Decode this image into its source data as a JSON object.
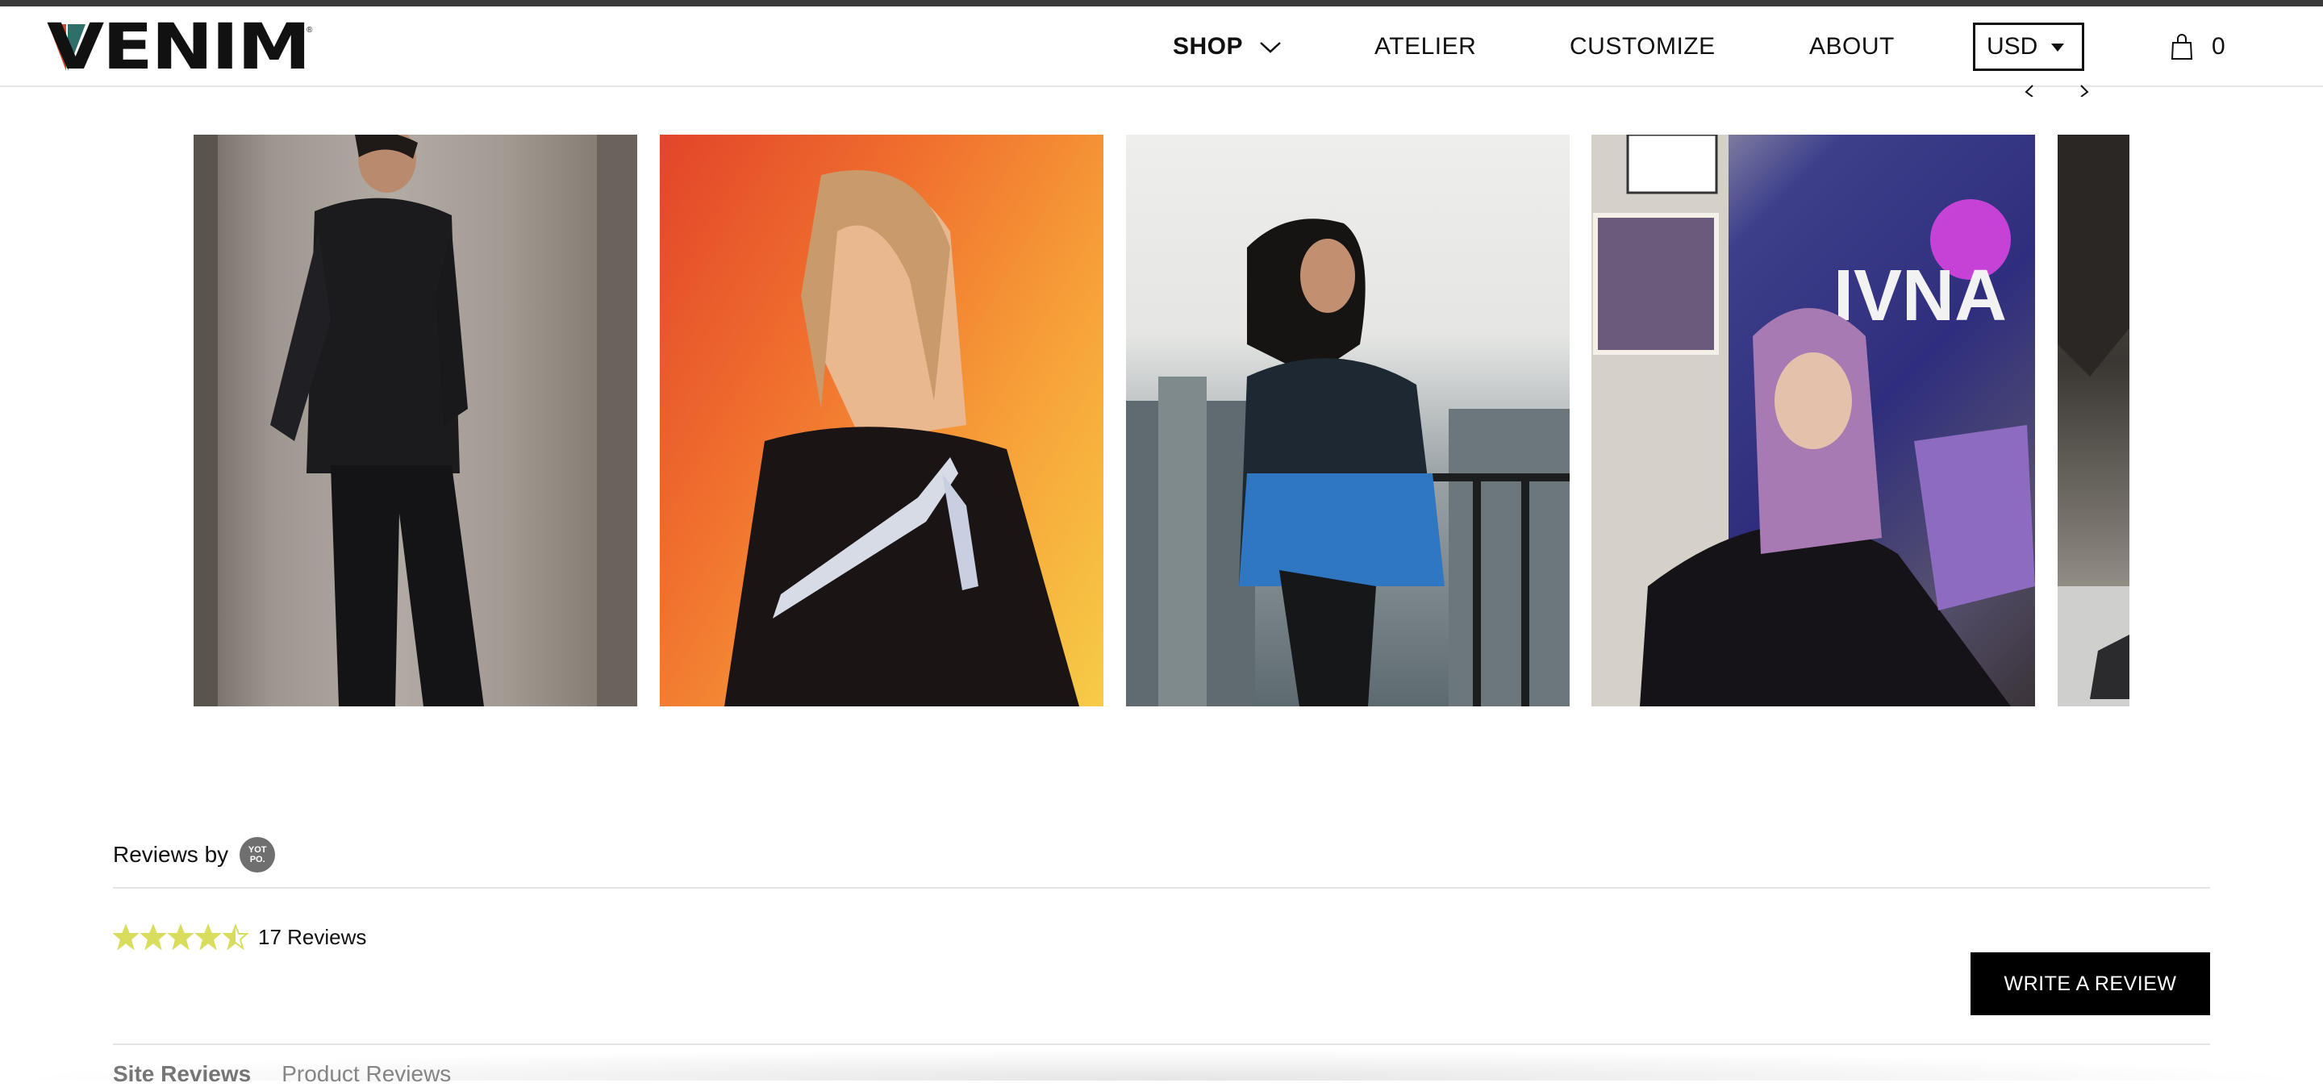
{
  "header": {
    "logo_text": "VENIM",
    "logo_reg": "®",
    "nav": {
      "shop": "SHOP",
      "atelier": "ATELIER",
      "customize": "CUSTOMIZE",
      "about": "ABOUT"
    },
    "currency": "USD",
    "cart_count": "0"
  },
  "gallery": {
    "photos": [
      {
        "alt": "man in black denim jacket against concrete wall"
      },
      {
        "alt": "woman in black jacket with printed sleeve on orange background"
      },
      {
        "alt": "woman in iridescent denim jacket on balcony"
      },
      {
        "alt": "woman with pastel hair in front of poster"
      },
      {
        "alt": "partial photo"
      }
    ]
  },
  "reviews": {
    "reviews_by": "Reviews by",
    "yotpo_badge": "YOT\nPO.",
    "rating": 4.5,
    "review_count": "17 Reviews",
    "write_review": "WRITE A REVIEW",
    "tabs": {
      "site": "Site Reviews",
      "product": "Product Reviews"
    }
  },
  "colors": {
    "star": "#d9dd5e",
    "button_bg": "#000000",
    "logo_accent_left": "#d2452d",
    "logo_accent_right": "#2f6f6a"
  }
}
